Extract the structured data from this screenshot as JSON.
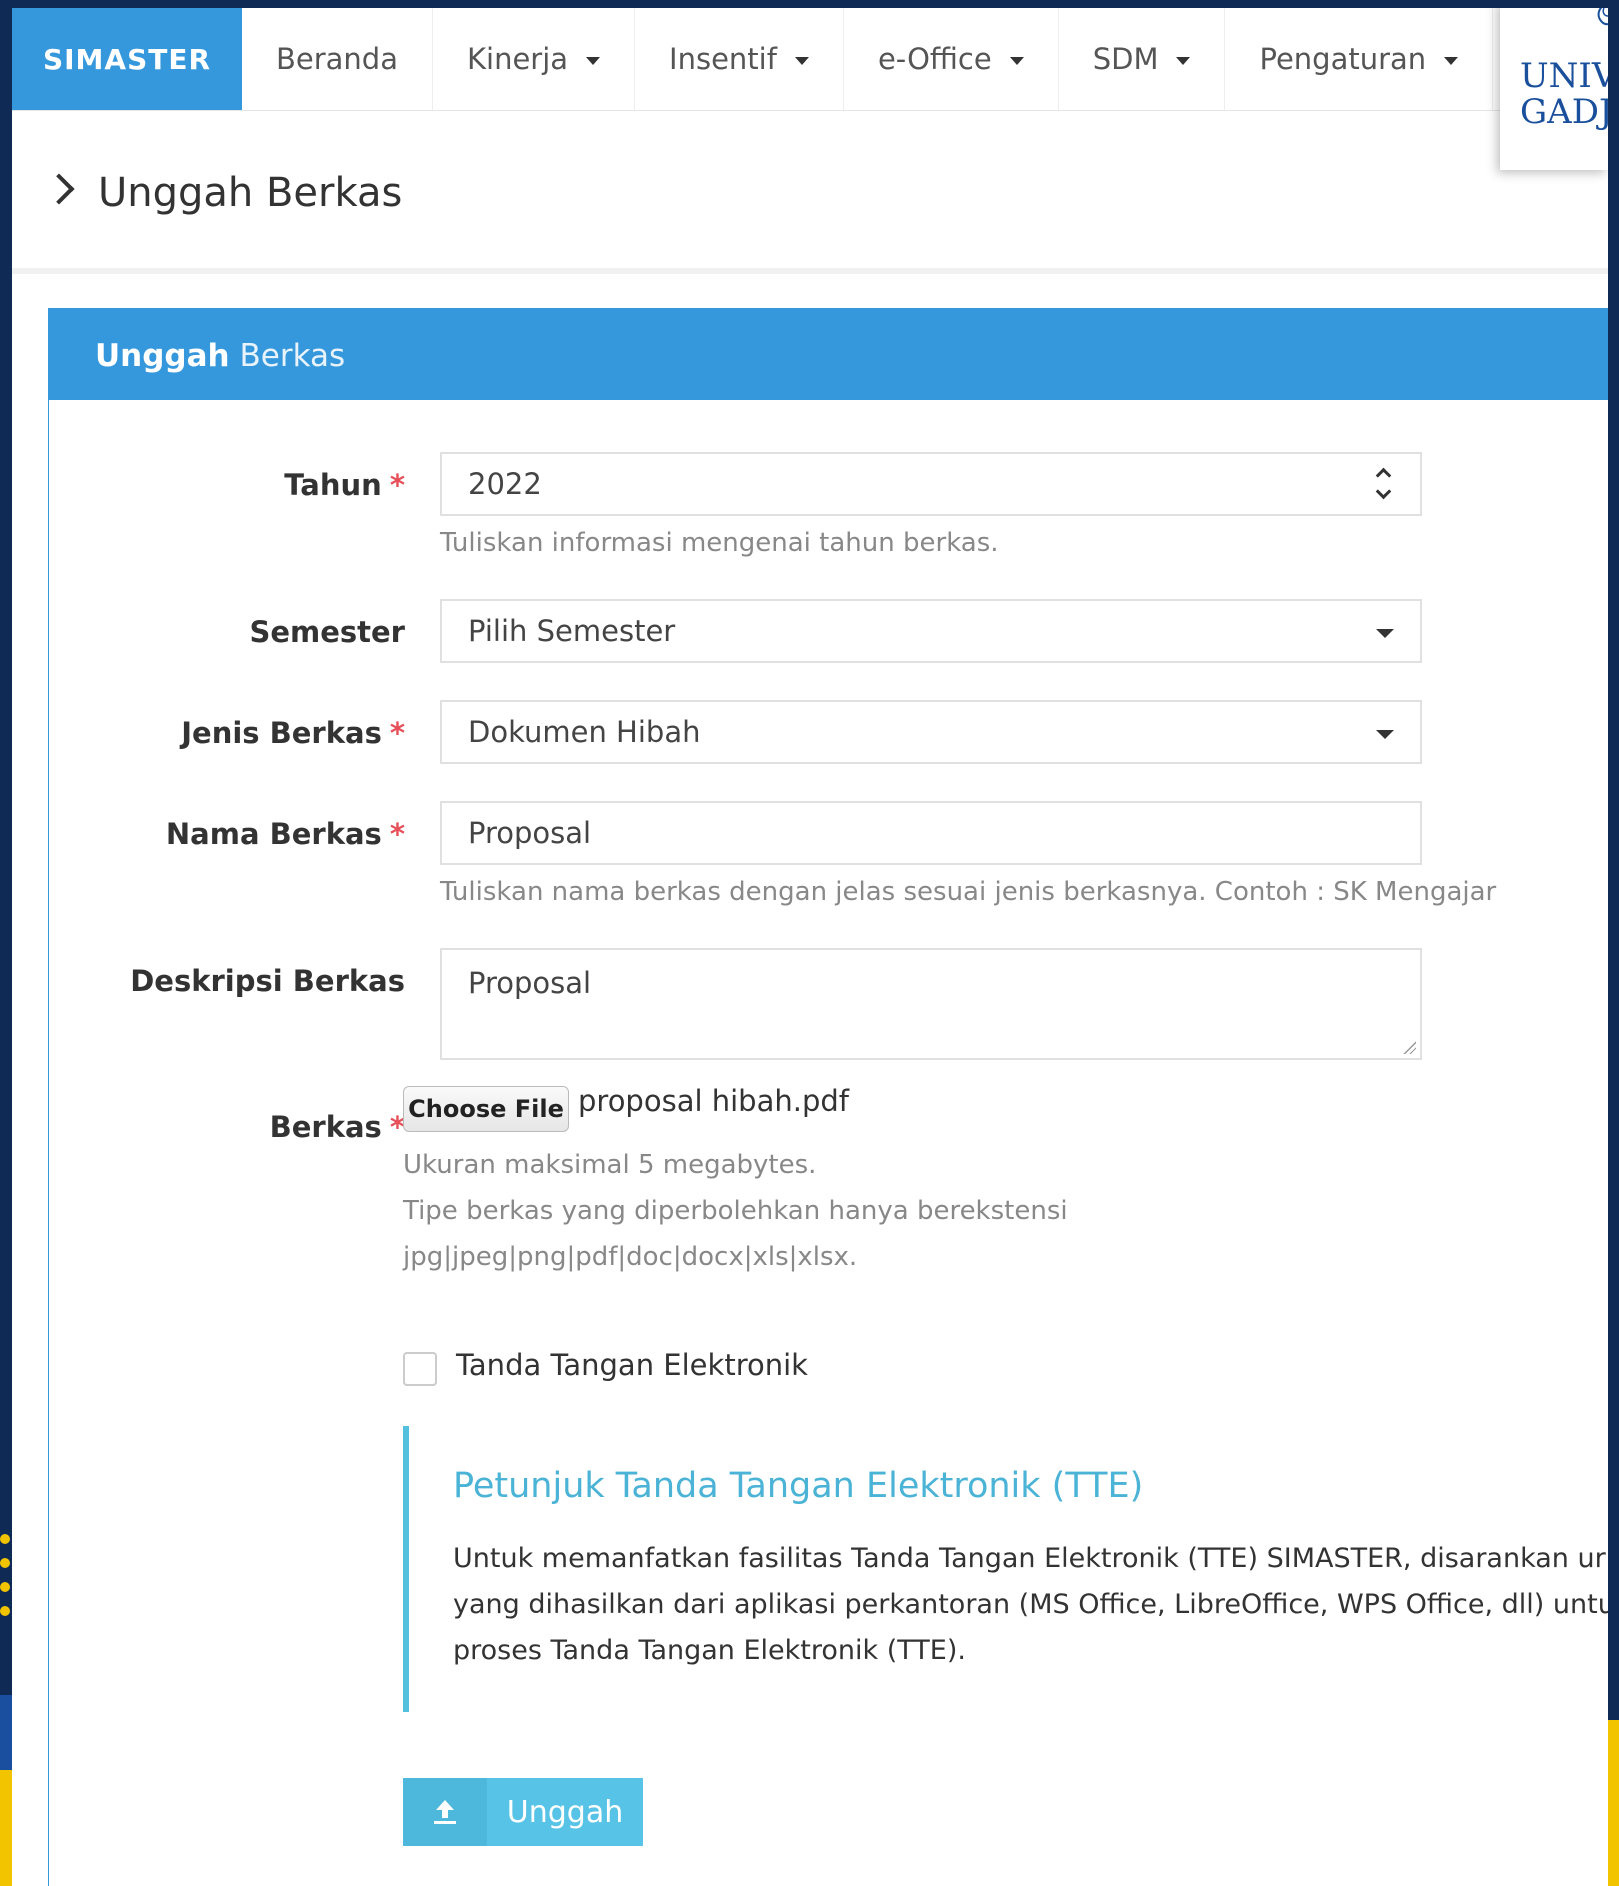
{
  "navbar": {
    "brand": "SIMASTER",
    "items": [
      {
        "label": "Beranda",
        "dropdown": false
      },
      {
        "label": "Kinerja",
        "dropdown": true
      },
      {
        "label": "Insentif",
        "dropdown": true
      },
      {
        "label": "e-Office",
        "dropdown": true
      },
      {
        "label": "SDM",
        "dropdown": true
      },
      {
        "label": "Pengaturan",
        "dropdown": true
      }
    ]
  },
  "logo": {
    "line1": "UNIV",
    "line2": "GADJ"
  },
  "page": {
    "title": "Unggah Berkas"
  },
  "portlet": {
    "title_bold": "Unggah",
    "title_rest": "Berkas"
  },
  "form": {
    "tahun": {
      "label": "Tahun",
      "required": "*",
      "value": "2022",
      "help": "Tuliskan informasi mengenai tahun berkas."
    },
    "semester": {
      "label": "Semester",
      "value": "Pilih Semester"
    },
    "jenis": {
      "label": "Jenis Berkas",
      "required": "*",
      "value": "Dokumen Hibah"
    },
    "nama": {
      "label": "Nama Berkas",
      "required": "*",
      "value": "Proposal",
      "help": "Tuliskan nama berkas dengan jelas sesuai jenis berkasnya. Contoh : SK Mengajar"
    },
    "deskripsi": {
      "label": "Deskripsi Berkas",
      "value": "Proposal"
    },
    "berkas": {
      "label": "Berkas",
      "required": "*",
      "button": "Choose File",
      "file_name": "proposal hibah.pdf",
      "help1": "Ukuran maksimal 5 megabytes.",
      "help2": "Tipe berkas yang diperbolehkan hanya berekstensi",
      "help3": "jpg|jpeg|png|pdf|doc|docx|xls|xlsx."
    },
    "tte": {
      "label": "Tanda Tangan Elektronik",
      "checked": false
    }
  },
  "note": {
    "title": "Petunjuk Tanda Tangan Elektronik (TTE)",
    "line1": "Untuk memanfatkan fasilitas Tanda Tangan Elektronik (TTE) SIMASTER, disarankan ur",
    "line2": "yang dihasilkan dari aplikasi perkantoran (MS Office, LibreOffice, WPS Office, dll) untu",
    "line3": "proses Tanda Tangan Elektronik (TTE)."
  },
  "submit": {
    "label": "Unggah",
    "icon": "upload-icon"
  },
  "colors": {
    "brand": "#3598dc",
    "accent": "#52c1de",
    "required": "#e7505a",
    "button": "#57c3e6"
  }
}
